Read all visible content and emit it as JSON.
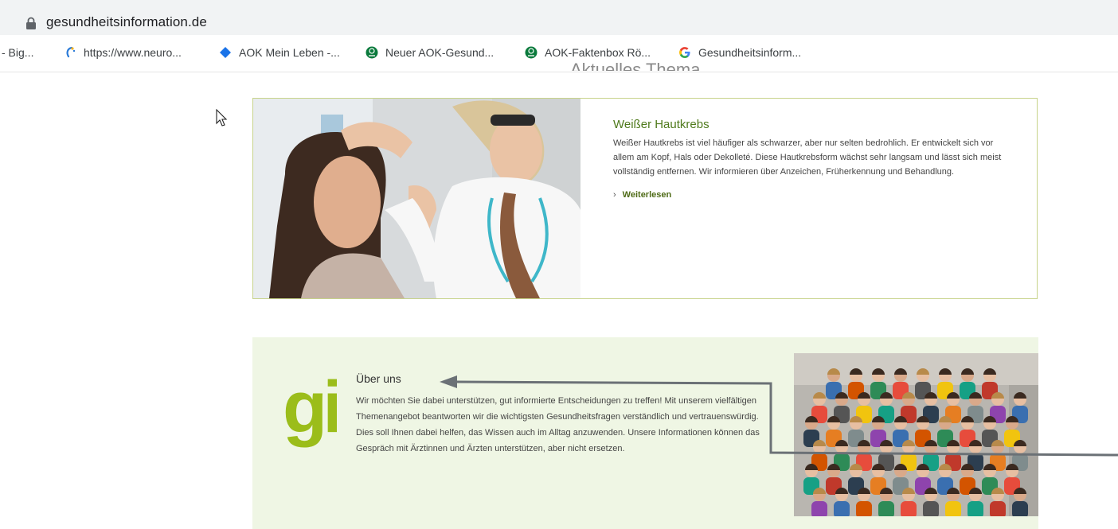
{
  "browser": {
    "url": "gesundheitsinformation.de"
  },
  "bookmarks": [
    {
      "label": "- Big...",
      "icon": "none"
    },
    {
      "label": "https://www.neuro...",
      "icon": "neuro-icon"
    },
    {
      "label": "AOK Mein Leben -...",
      "icon": "diamond-icon"
    },
    {
      "label": "Neuer AOK-Gesund...",
      "icon": "aok-logo-icon"
    },
    {
      "label": "AOK-Faktenbox Rö...",
      "icon": "aok-logo-icon"
    },
    {
      "label": "Gesundheitsinform...",
      "icon": "google-icon"
    }
  ],
  "section_heading": "Aktuelles Thema",
  "feature": {
    "title": "Weißer Hautkrebs",
    "body": "Weißer Hautkrebs ist viel häufiger als schwarzer, aber nur selten bedrohlich. Er entwickelt sich vor allem am Kopf, Hals oder Dekolleté. Diese Hautkrebsform wächst sehr langsam und lässt sich meist vollständig entfernen. Wir informieren über Anzeichen, Früherkennung und Behandlung.",
    "link_label": "Weiterlesen"
  },
  "about": {
    "logo_text": "gi",
    "title": "Über uns",
    "body": "Wir möchten Sie dabei unterstützen, gut informierte Entscheidungen zu treffen! Mit unserem vielfältigen Themenangebot beantworten wir die wichtigsten Gesundheitsfragen verständlich und vertrauenswürdig. Dies soll Ihnen dabei helfen, das Wissen auch im Alltag anzuwenden. Unsere Informationen können das Gespräch mit Ärztinnen und Ärzten unterstützen, aber nicht ersetzen."
  },
  "colors": {
    "accent_green": "#9bbd1a",
    "link_green": "#4f6b17",
    "card_border": "#c7d38a",
    "about_bg": "#eff6e4",
    "annotation_gray": "#6b7176"
  }
}
